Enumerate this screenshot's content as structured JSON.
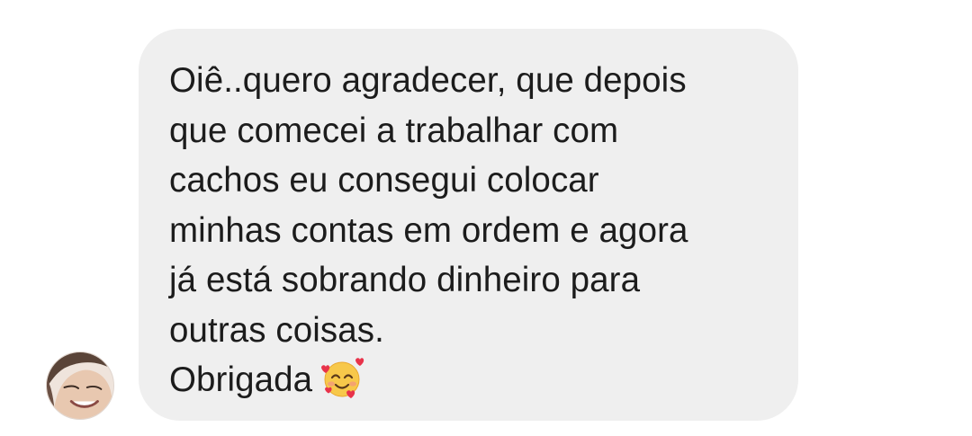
{
  "message": {
    "body": "Oiê..quero agradecer, que depois\nque comecei a trabalhar com\ncachos eu consegui colocar\nminhas contas em ordem e agora\njá está sobrando dinheiro para\noutras coisas.",
    "closing": "Obrigada",
    "emoji": "smiling-face-with-hearts-icon"
  },
  "colors": {
    "bubble_background": "#efefef",
    "text": "#1c1c1c",
    "page_background": "#ffffff"
  }
}
